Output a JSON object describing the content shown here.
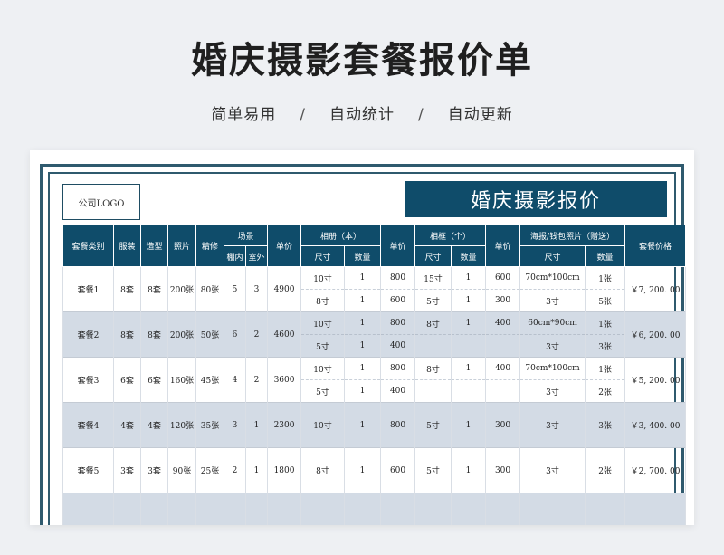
{
  "header": {
    "title": "婚庆摄影套餐报价单",
    "subtitle_items": [
      "简单易用",
      "自动统计",
      "自动更新"
    ],
    "separator": "/"
  },
  "sheet": {
    "logo": "公司LOGO",
    "title": "婚庆摄影报价"
  },
  "columns": {
    "package_type": "套餐类别",
    "clothing": "服装",
    "styling": "造型",
    "photos": "照片",
    "retouch": "精修",
    "scene": "场景",
    "indoor": "棚内",
    "outdoor": "室外",
    "unit_price": "单价",
    "album": "相册（本）",
    "frame": "相框（个）",
    "poster": "海报/钱包照片（赠送）",
    "size": "尺寸",
    "qty": "数量",
    "total": "套餐价格"
  },
  "rows": [
    {
      "name": "套餐1",
      "clothing": "8套",
      "styling": "8套",
      "photos": "200张",
      "retouch": "80张",
      "indoor": "5",
      "outdoor": "3",
      "price": "4900",
      "total": "￥7, 200. 00",
      "lines": [
        {
          "album_size": "10寸",
          "album_qty": "1",
          "album_price": "800",
          "frame_size": "15寸",
          "frame_qty": "1",
          "frame_price": "600",
          "poster_size": "70cm*100cm",
          "poster_qty": "1张"
        },
        {
          "album_size": "8寸",
          "album_qty": "1",
          "album_price": "600",
          "frame_size": "5寸",
          "frame_qty": "1",
          "frame_price": "300",
          "poster_size": "3寸",
          "poster_qty": "5张"
        }
      ]
    },
    {
      "name": "套餐2",
      "clothing": "8套",
      "styling": "8套",
      "photos": "200张",
      "retouch": "50张",
      "indoor": "6",
      "outdoor": "2",
      "price": "4600",
      "total": "￥6, 200. 00",
      "lines": [
        {
          "album_size": "10寸",
          "album_qty": "1",
          "album_price": "800",
          "frame_size": "8寸",
          "frame_qty": "1",
          "frame_price": "400",
          "poster_size": "60cm*90cm",
          "poster_qty": "1张"
        },
        {
          "album_size": "5寸",
          "album_qty": "1",
          "album_price": "400",
          "frame_size": "",
          "frame_qty": "",
          "frame_price": "",
          "poster_size": "3寸",
          "poster_qty": "3张"
        }
      ]
    },
    {
      "name": "套餐3",
      "clothing": "6套",
      "styling": "6套",
      "photos": "160张",
      "retouch": "45张",
      "indoor": "4",
      "outdoor": "2",
      "price": "3600",
      "total": "￥5, 200. 00",
      "lines": [
        {
          "album_size": "10寸",
          "album_qty": "1",
          "album_price": "800",
          "frame_size": "8寸",
          "frame_qty": "1",
          "frame_price": "400",
          "poster_size": "70cm*100cm",
          "poster_qty": "1张"
        },
        {
          "album_size": "5寸",
          "album_qty": "1",
          "album_price": "400",
          "frame_size": "",
          "frame_qty": "",
          "frame_price": "",
          "poster_size": "3寸",
          "poster_qty": "2张"
        }
      ]
    },
    {
      "name": "套餐4",
      "clothing": "4套",
      "styling": "4套",
      "photos": "120张",
      "retouch": "35张",
      "indoor": "3",
      "outdoor": "1",
      "price": "2300",
      "total": "￥3, 400. 00",
      "lines": [
        {
          "album_size": "10寸",
          "album_qty": "1",
          "album_price": "800",
          "frame_size": "5寸",
          "frame_qty": "1",
          "frame_price": "300",
          "poster_size": "3寸",
          "poster_qty": "3张"
        }
      ]
    },
    {
      "name": "套餐5",
      "clothing": "3套",
      "styling": "3套",
      "photos": "90张",
      "retouch": "25张",
      "indoor": "2",
      "outdoor": "1",
      "price": "1800",
      "total": "￥2, 700. 00",
      "lines": [
        {
          "album_size": "8寸",
          "album_qty": "1",
          "album_price": "600",
          "frame_size": "5寸",
          "frame_qty": "1",
          "frame_price": "300",
          "poster_size": "3寸",
          "poster_qty": "2张"
        }
      ]
    }
  ]
}
